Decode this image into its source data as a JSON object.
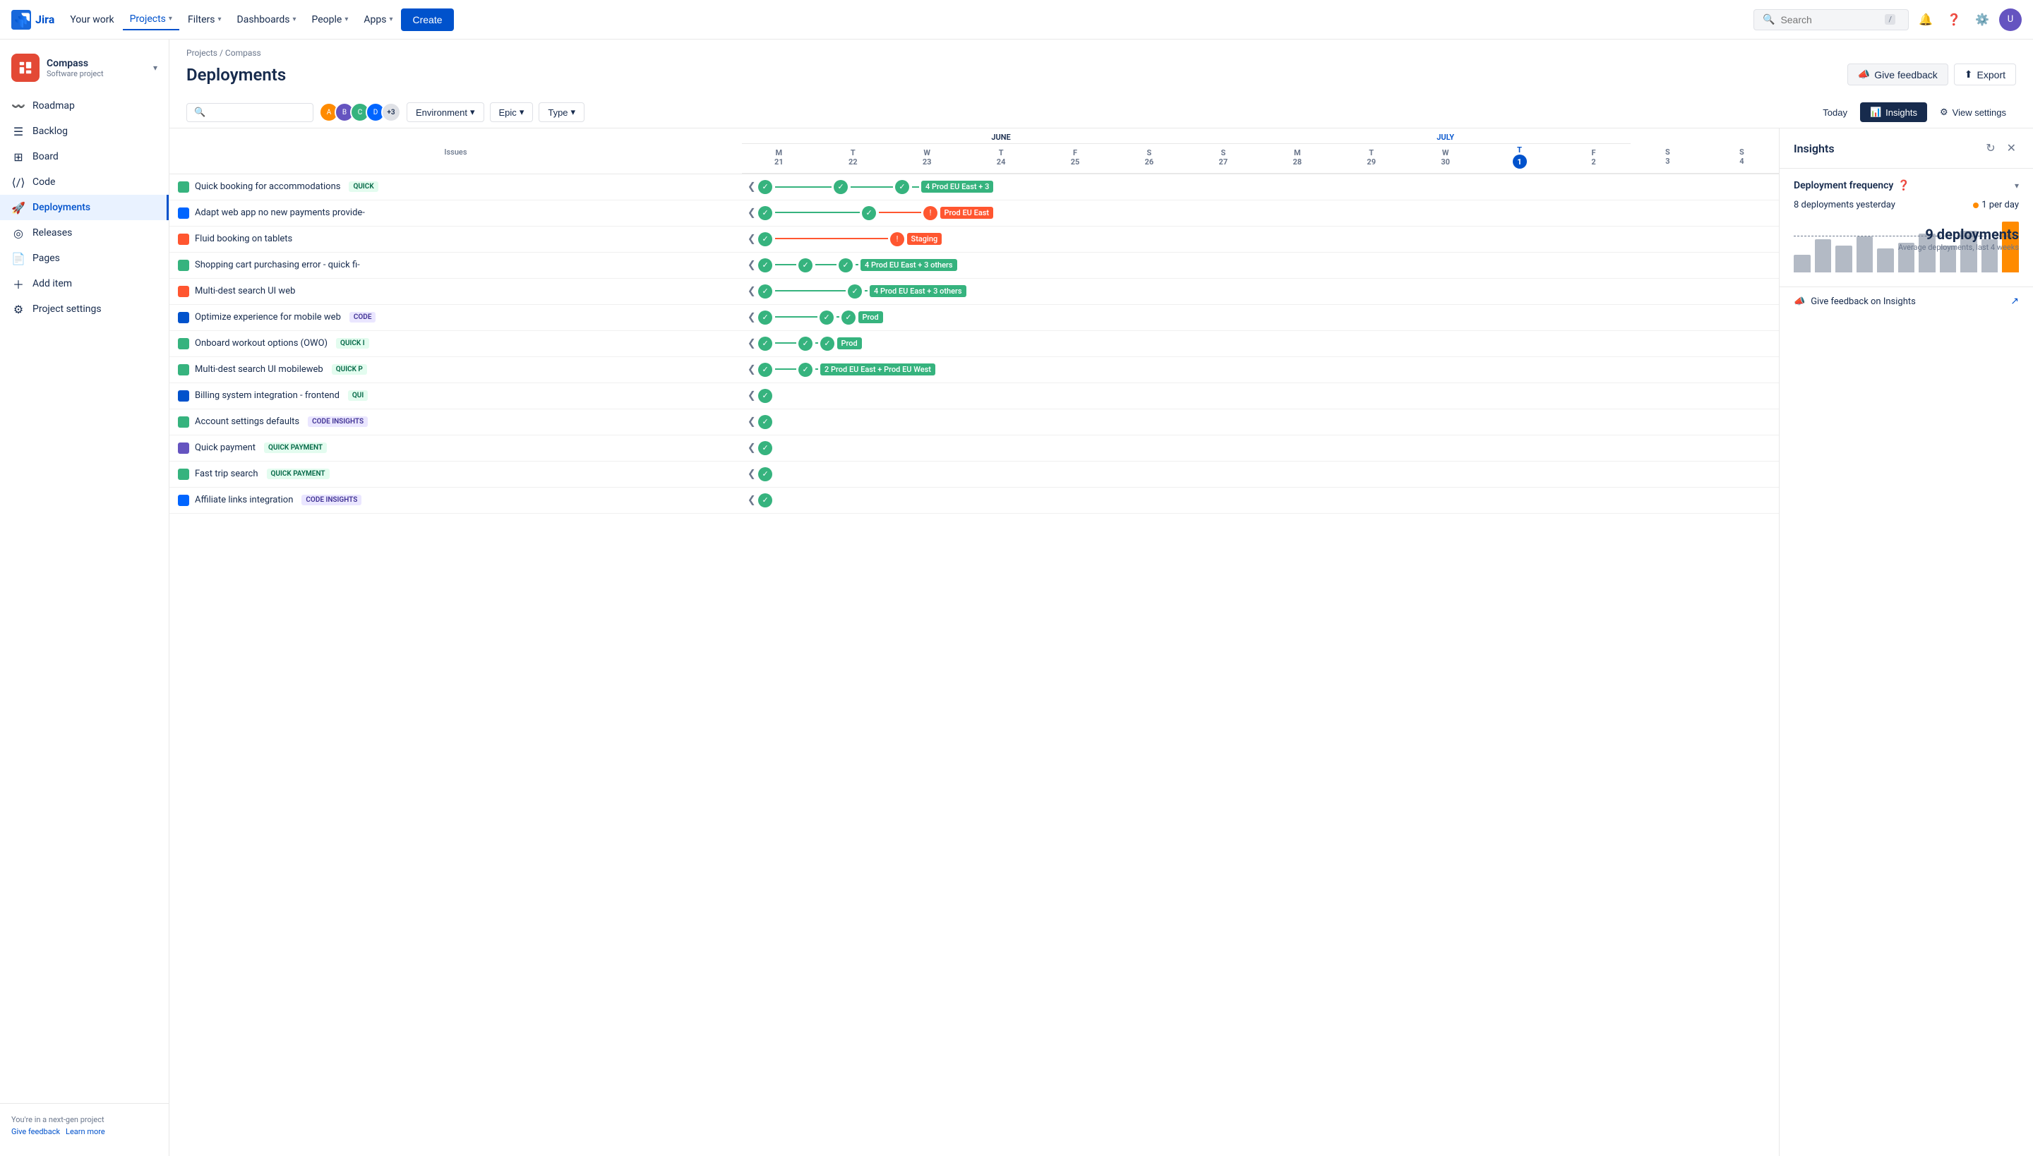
{
  "nav": {
    "logo_text": "Jira",
    "items": [
      {
        "label": "Your work",
        "active": false
      },
      {
        "label": "Projects",
        "active": true
      },
      {
        "label": "Filters",
        "active": false
      },
      {
        "label": "Dashboards",
        "active": false
      },
      {
        "label": "People",
        "active": false
      },
      {
        "label": "Apps",
        "active": false
      }
    ],
    "create_label": "Create",
    "search_placeholder": "Search",
    "search_shortcut": "/"
  },
  "sidebar": {
    "project_name": "Compass",
    "project_type": "Software project",
    "items": [
      {
        "label": "Roadmap",
        "icon": "roadmap"
      },
      {
        "label": "Backlog",
        "icon": "backlog"
      },
      {
        "label": "Board",
        "icon": "board"
      },
      {
        "label": "Code",
        "icon": "code"
      },
      {
        "label": "Deployments",
        "icon": "deployments",
        "active": true
      },
      {
        "label": "Releases",
        "icon": "releases"
      },
      {
        "label": "Pages",
        "icon": "pages"
      },
      {
        "label": "Add item",
        "icon": "add"
      },
      {
        "label": "Project settings",
        "icon": "settings"
      }
    ],
    "footer_text": "You're in a next-gen project",
    "footer_links": [
      "Give feedback",
      "Learn more"
    ]
  },
  "breadcrumb": {
    "items": [
      "Projects",
      "Compass"
    ]
  },
  "page": {
    "title": "Deployments",
    "give_feedback_label": "Give feedback",
    "export_label": "Export"
  },
  "toolbar": {
    "search_placeholder": "",
    "filters": [
      "Environment",
      "Epic",
      "Type"
    ],
    "view_today": "Today",
    "view_insights": "Insights",
    "view_settings": "View settings"
  },
  "calendar": {
    "months": [
      {
        "label": "JUNE",
        "colspan": 7
      },
      {
        "label": "JULY",
        "colspan": 5
      }
    ],
    "days": [
      {
        "day": "M",
        "num": "21",
        "today": false
      },
      {
        "day": "T",
        "num": "22",
        "today": false
      },
      {
        "day": "W",
        "num": "23",
        "today": false
      },
      {
        "day": "T",
        "num": "24",
        "today": false
      },
      {
        "day": "F",
        "num": "25",
        "today": false
      },
      {
        "day": "S",
        "num": "26",
        "today": false
      },
      {
        "day": "S",
        "num": "27",
        "today": false
      },
      {
        "day": "M",
        "num": "28",
        "today": false
      },
      {
        "day": "T",
        "num": "29",
        "today": false
      },
      {
        "day": "W",
        "num": "30",
        "today": false
      },
      {
        "day": "T",
        "num": "1",
        "today": true
      },
      {
        "day": "F",
        "num": "2",
        "today": false
      },
      {
        "day": "S",
        "num": "3",
        "today": false
      },
      {
        "day": "S",
        "num": "4",
        "today": false
      }
    ]
  },
  "issues_header": "Issues",
  "issues": [
    {
      "type": "story",
      "name": "Quick booking for accommodations",
      "tag": "QUICK",
      "tag_style": "quick",
      "env": "Prod EU East + 3",
      "env_count": true,
      "status": "success",
      "has_error": false
    },
    {
      "type": "subtask",
      "name": "Adapt web app no new payments provide-",
      "tag": "",
      "tag_style": "",
      "env": "Prod EU East",
      "env_count": false,
      "status": "error",
      "has_error": true
    },
    {
      "type": "bug",
      "name": "Fluid booking on tablets",
      "tag": "",
      "tag_style": "",
      "env": "Staging",
      "env_count": false,
      "status": "error",
      "has_error": true
    },
    {
      "type": "story",
      "name": "Shopping cart purchasing error - quick fi-",
      "tag": "",
      "tag_style": "",
      "env": "Prod EU East + 3 others",
      "env_count": true,
      "status": "success",
      "has_error": false
    },
    {
      "type": "bug",
      "name": "Multi-dest search UI web",
      "tag": "",
      "tag_style": "",
      "env": "Prod EU East + 3 others",
      "env_count": true,
      "status": "success",
      "has_error": false
    },
    {
      "type": "task",
      "name": "Optimize experience for mobile web",
      "tag": "CODE",
      "tag_style": "code",
      "env": "Prod",
      "env_count": false,
      "status": "success",
      "has_error": false
    },
    {
      "type": "story",
      "name": "Onboard workout options (OWO)",
      "tag": "QUICK I",
      "tag_style": "quick",
      "env": "Prod",
      "env_count": false,
      "status": "success",
      "has_error": false
    },
    {
      "type": "story",
      "name": "Multi-dest search UI mobileweb",
      "tag": "QUICK P",
      "tag_style": "quick",
      "env": "Prod EU East + Prod EU West",
      "env_count": true,
      "status": "success",
      "has_error": false
    },
    {
      "type": "task",
      "name": "Billing system integration - frontend",
      "tag": "QUI",
      "tag_style": "quick",
      "env": "",
      "env_count": false,
      "status": "partial",
      "has_error": false
    },
    {
      "type": "story",
      "name": "Account settings defaults",
      "tag": "CODE INSIGHTS",
      "tag_style": "code",
      "env": "",
      "env_count": false,
      "status": "partial",
      "has_error": false
    },
    {
      "type": "special",
      "name": "Quick payment",
      "tag": "QUICK PAYMENT",
      "tag_style": "payment",
      "env": "",
      "env_count": false,
      "status": "partial",
      "has_error": false
    },
    {
      "type": "story",
      "name": "Fast trip search",
      "tag": "QUICK PAYMENT",
      "tag_style": "payment",
      "env": "",
      "env_count": false,
      "status": "partial",
      "has_error": false
    },
    {
      "type": "subtask",
      "name": "Affiliate links integration",
      "tag": "CODE INSIGHTS",
      "tag_style": "code",
      "env": "",
      "env_count": false,
      "status": "partial",
      "has_error": false
    }
  ],
  "insights": {
    "title": "Insights",
    "deployment_frequency_title": "Deployment frequency",
    "deployments_yesterday": "8 deployments yesterday",
    "rate_label": "1 per day",
    "chart_label": "9 deployments",
    "chart_sub": "Average deployments, last 4 weeks",
    "chart_bars": [
      30,
      55,
      45,
      60,
      40,
      50,
      65,
      45,
      70,
      55,
      85
    ],
    "feedback_label": "Give feedback on Insights"
  }
}
